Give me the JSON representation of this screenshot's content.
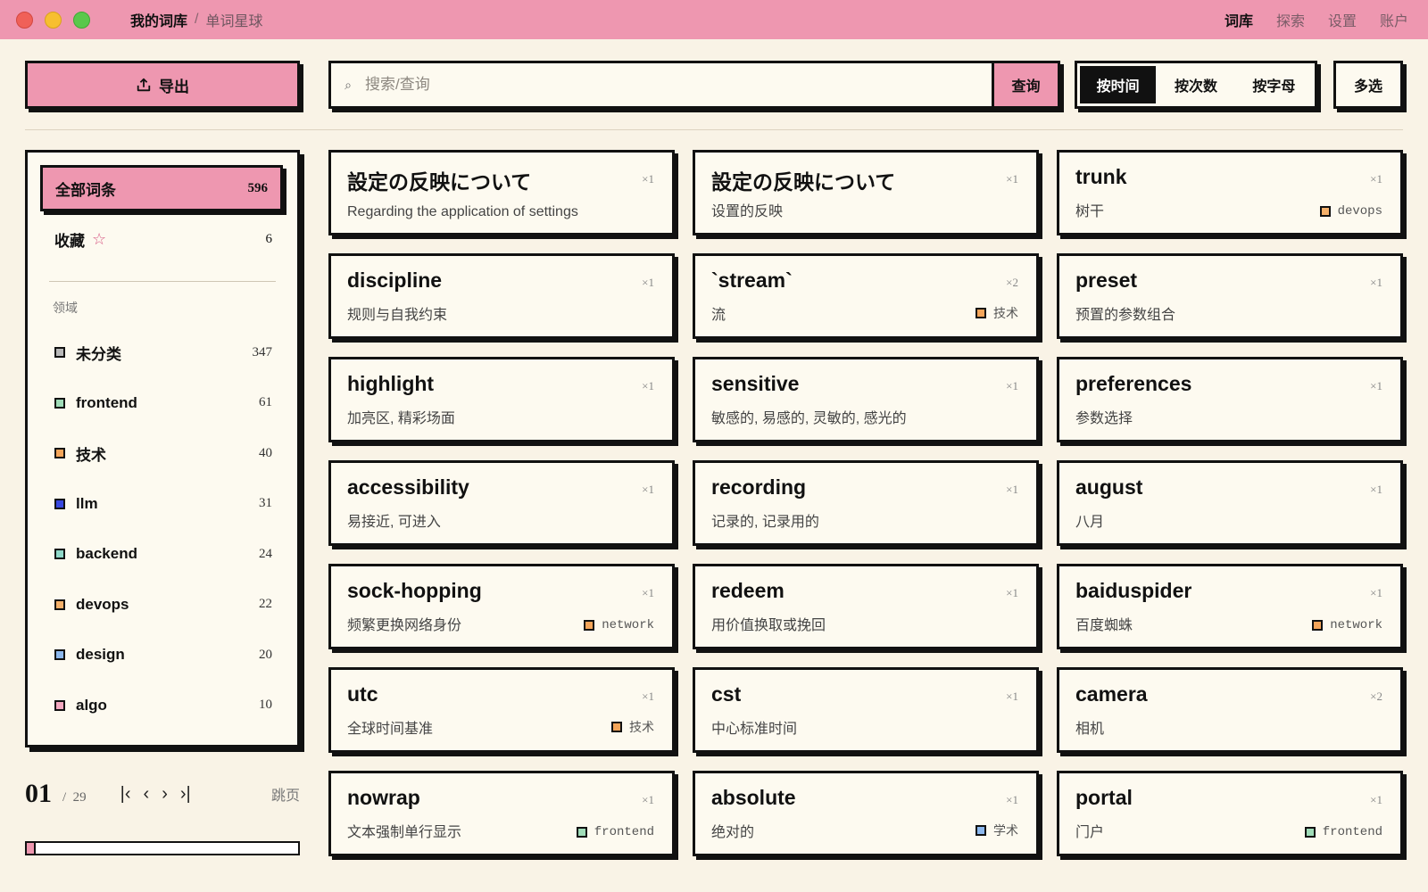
{
  "window": {
    "controls": [
      "close",
      "minimize",
      "maximize"
    ]
  },
  "breadcrumb": {
    "current": "我的词库",
    "separator": "/",
    "app": "单词星球"
  },
  "topnav": [
    {
      "label": "词库",
      "active": true
    },
    {
      "label": "探索",
      "active": false
    },
    {
      "label": "设置",
      "active": false
    },
    {
      "label": "账户",
      "active": false
    }
  ],
  "toolbar": {
    "export_label": "导出",
    "search_placeholder": "搜索/查询",
    "search_value": "",
    "query_label": "查询",
    "sort_options": [
      {
        "label": "按时间",
        "active": true
      },
      {
        "label": "按次数",
        "active": false
      },
      {
        "label": "按字母",
        "active": false
      }
    ],
    "multi_select_label": "多选"
  },
  "sidebar": {
    "all": {
      "label": "全部词条",
      "count": "596"
    },
    "favorites": {
      "label": "收藏",
      "count": "6"
    },
    "domain_heading": "领域",
    "domains": [
      {
        "label": "未分类",
        "count": "347",
        "color": "#b9b9b9"
      },
      {
        "label": "frontend",
        "count": "61",
        "color": "#9fdcb8"
      },
      {
        "label": "技术",
        "count": "40",
        "color": "#f4a55a"
      },
      {
        "label": "llm",
        "count": "31",
        "color": "#3848e0"
      },
      {
        "label": "backend",
        "count": "24",
        "color": "#8fd8c8"
      },
      {
        "label": "devops",
        "count": "22",
        "color": "#f4b06a"
      },
      {
        "label": "design",
        "count": "20",
        "color": "#8cb8ee"
      },
      {
        "label": "algo",
        "count": "10",
        "color": "#f4a8c0"
      }
    ]
  },
  "pagination": {
    "current": "01",
    "total": "29",
    "jump_label": "跳页",
    "progress_fraction": 0.034
  },
  "cards": [
    {
      "word": "設定の反映について",
      "meaning": "Regarding the application of settings",
      "count": "×1",
      "tag": null
    },
    {
      "word": "設定の反映について",
      "meaning": "设置的反映",
      "count": "×1",
      "tag": null
    },
    {
      "word": "trunk",
      "meaning": "树干",
      "count": "×1",
      "tag": {
        "label": "devops",
        "color": "#f4b06a"
      }
    },
    {
      "word": "discipline",
      "meaning": "规则与自我约束",
      "count": "×1",
      "tag": null
    },
    {
      "word": "`stream`",
      "meaning": "流",
      "count": "×2",
      "tag": {
        "label": "技术",
        "color": "#f4a55a"
      }
    },
    {
      "word": "preset",
      "meaning": "预置的参数组合",
      "count": "×1",
      "tag": null
    },
    {
      "word": "highlight",
      "meaning": "加亮区, 精彩场面",
      "count": "×1",
      "tag": null
    },
    {
      "word": "sensitive",
      "meaning": "敏感的, 易感的, 灵敏的, 感光的",
      "count": "×1",
      "tag": null
    },
    {
      "word": "preferences",
      "meaning": "参数选择",
      "count": "×1",
      "tag": null
    },
    {
      "word": "accessibility",
      "meaning": "易接近, 可进入",
      "count": "×1",
      "tag": null
    },
    {
      "word": "recording",
      "meaning": "记录的, 记录用的",
      "count": "×1",
      "tag": null
    },
    {
      "word": "august",
      "meaning": "八月",
      "count": "×1",
      "tag": null
    },
    {
      "word": "sock-hopping",
      "meaning": "频繁更换网络身份",
      "count": "×1",
      "tag": {
        "label": "network",
        "color": "#f4a55a"
      }
    },
    {
      "word": "redeem",
      "meaning": "用价值换取或挽回",
      "count": "×1",
      "tag": null
    },
    {
      "word": "baiduspider",
      "meaning": "百度蜘蛛",
      "count": "×1",
      "tag": {
        "label": "network",
        "color": "#f4a55a"
      }
    },
    {
      "word": "utc",
      "meaning": "全球时间基准",
      "count": "×1",
      "tag": {
        "label": "技术",
        "color": "#f4a55a"
      }
    },
    {
      "word": "cst",
      "meaning": "中心标准时间",
      "count": "×1",
      "tag": null
    },
    {
      "word": "camera",
      "meaning": "相机",
      "count": "×2",
      "tag": null
    },
    {
      "word": "nowrap",
      "meaning": "文本强制单行显示",
      "count": "×1",
      "tag": {
        "label": "frontend",
        "color": "#9fdcb8"
      }
    },
    {
      "word": "absolute",
      "meaning": "绝对的",
      "count": "×1",
      "tag": {
        "label": "学术",
        "color": "#8cb8ee"
      }
    },
    {
      "word": "portal",
      "meaning": "门户",
      "count": "×1",
      "tag": {
        "label": "frontend",
        "color": "#9fdcb8"
      }
    }
  ]
}
